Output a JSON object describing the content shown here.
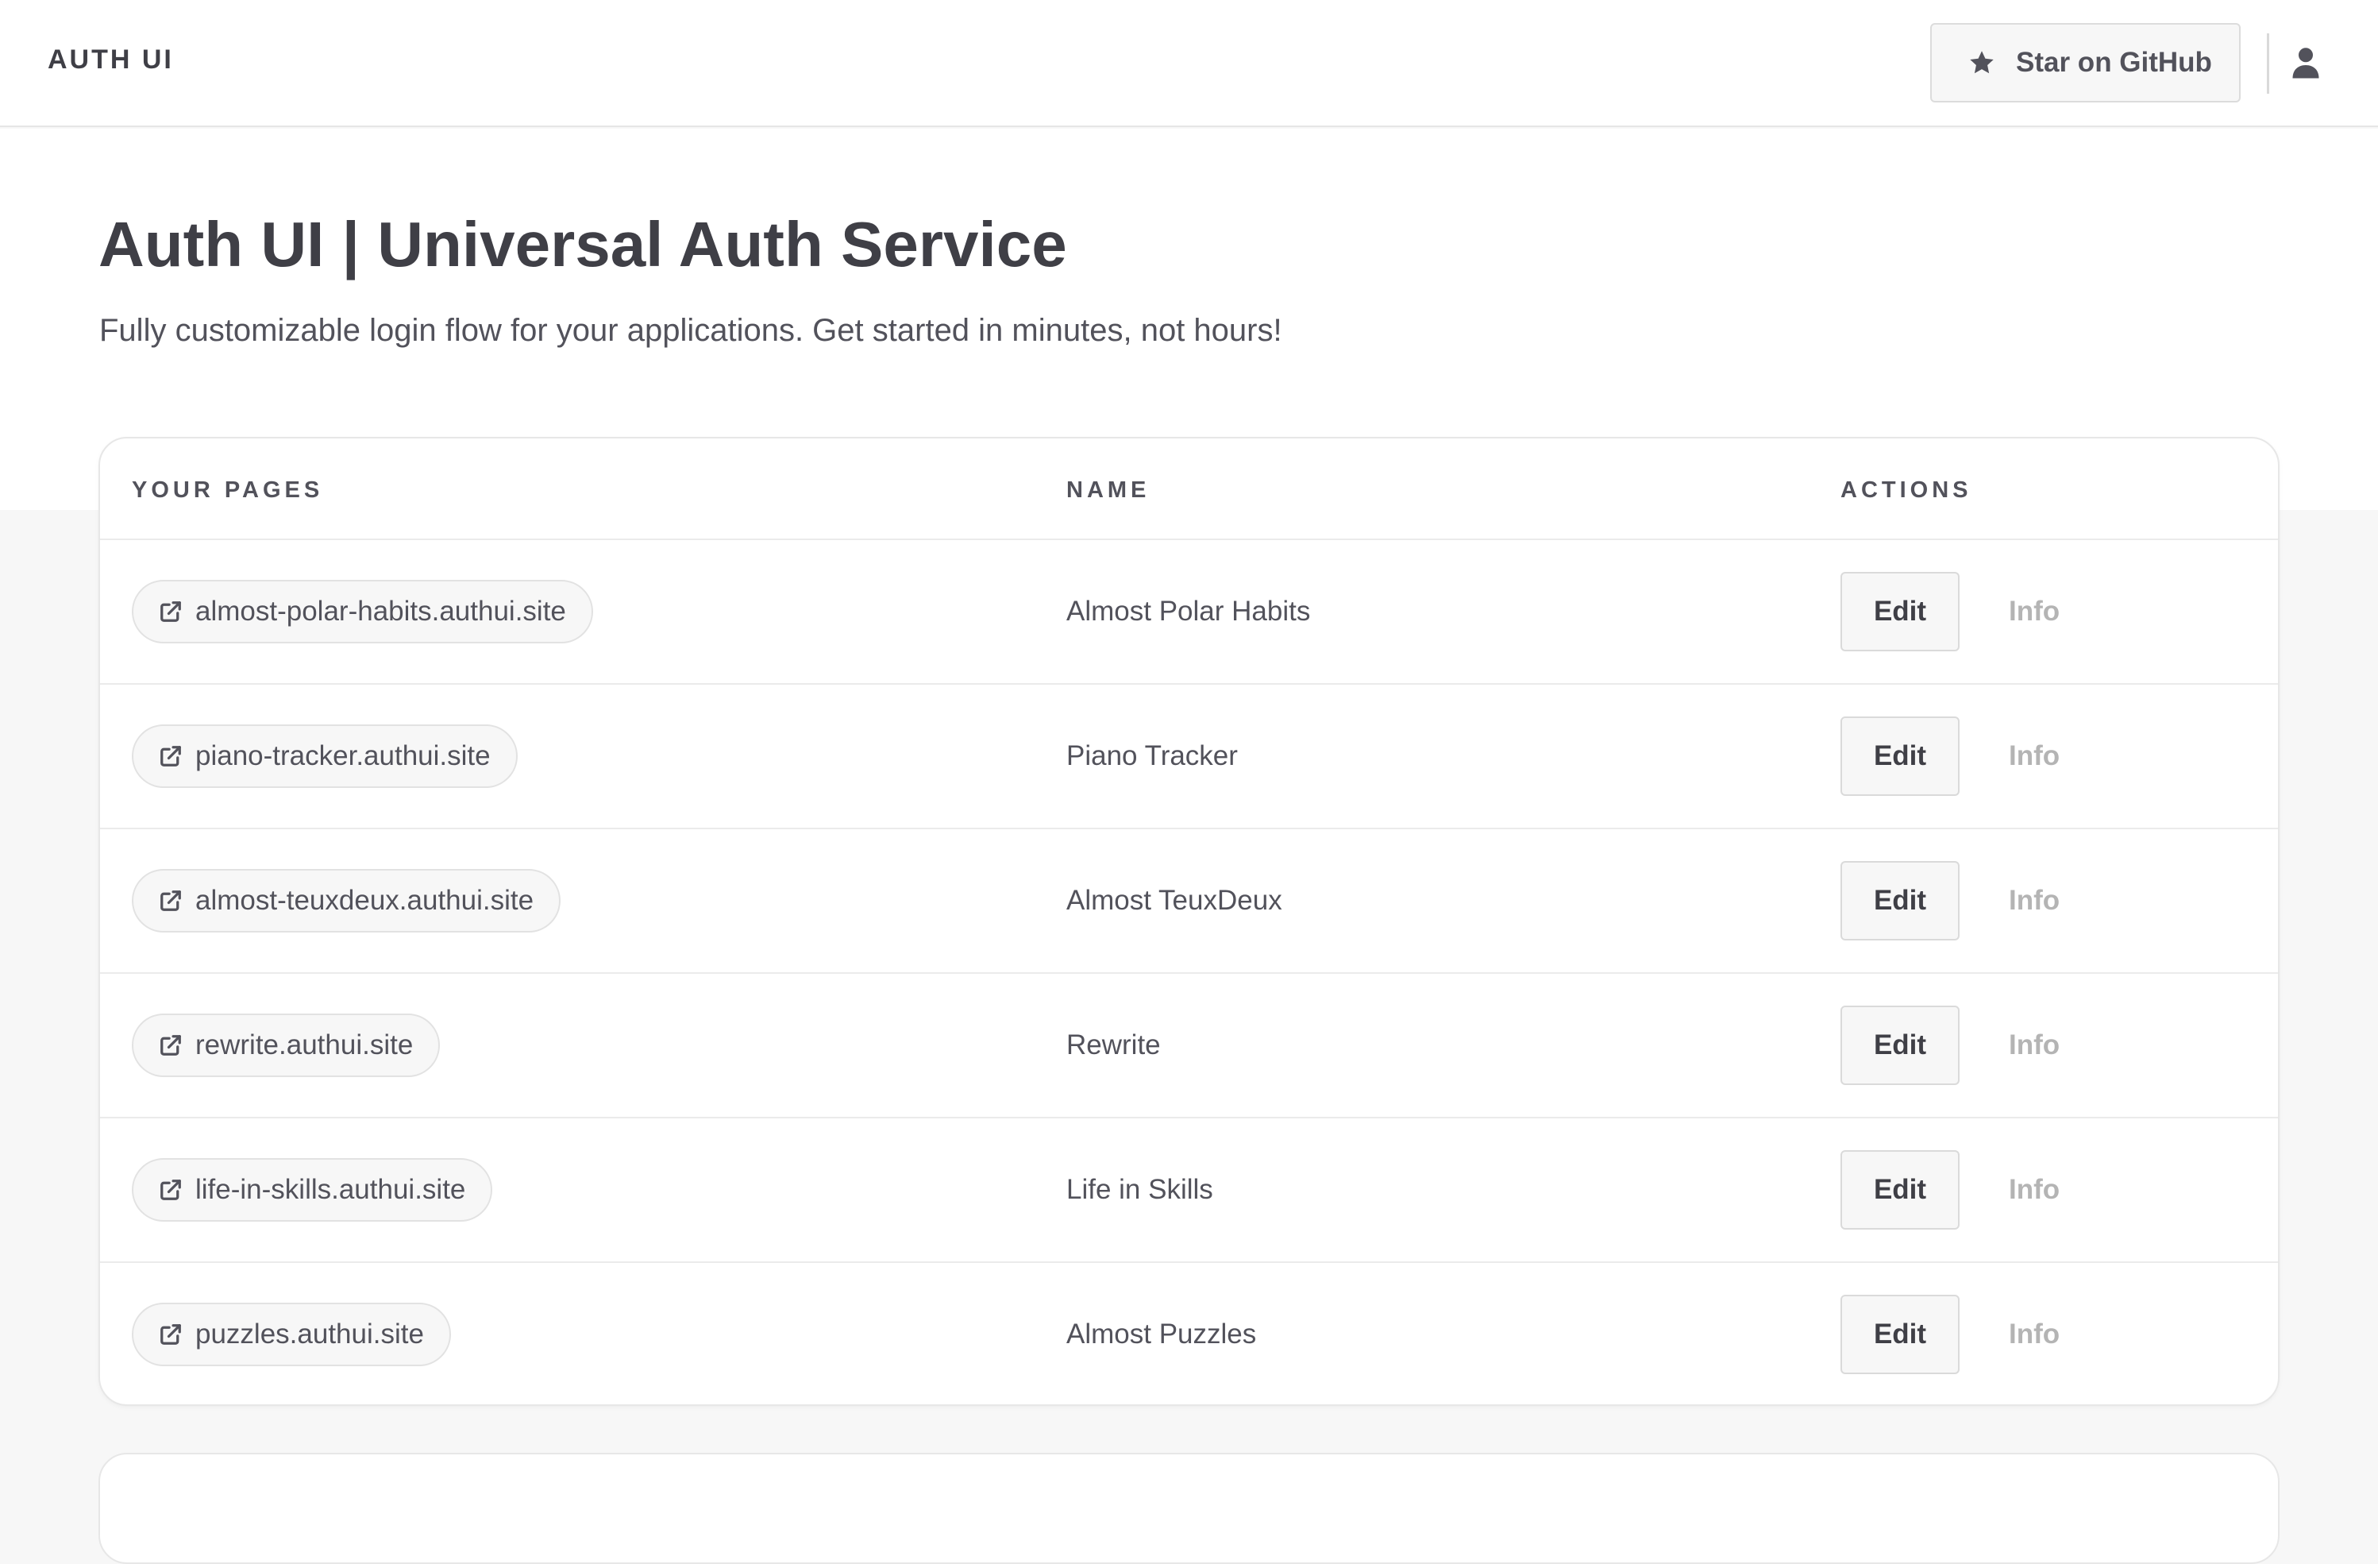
{
  "header": {
    "brand": "AUTH UI",
    "github_button_label": "Star on GitHub",
    "icons": [
      "star-icon",
      "user-icon"
    ]
  },
  "hero": {
    "title": "Auth UI | Universal Auth Service",
    "subtitle": "Fully customizable login flow for your applications. Get started in minutes, not hours!"
  },
  "table": {
    "headers": [
      "YOUR PAGES",
      "NAME",
      "ACTIONS"
    ],
    "edit_label": "Edit",
    "info_label": "Info",
    "rows": [
      {
        "url": "almost-polar-habits.authui.site",
        "name": "Almost Polar Habits"
      },
      {
        "url": "piano-tracker.authui.site",
        "name": "Piano Tracker"
      },
      {
        "url": "almost-teuxdeux.authui.site",
        "name": "Almost TeuxDeux"
      },
      {
        "url": "rewrite.authui.site",
        "name": "Rewrite"
      },
      {
        "url": "life-in-skills.authui.site",
        "name": "Life in Skills"
      },
      {
        "url": "puzzles.authui.site",
        "name": "Almost Puzzles"
      }
    ]
  },
  "colors": {
    "text": "#3f3f46",
    "muted_text": "#52525b",
    "info_text": "#b4b4b4",
    "background": "#f7f7f7",
    "surface": "#ffffff",
    "border": "#e7e7e7"
  }
}
